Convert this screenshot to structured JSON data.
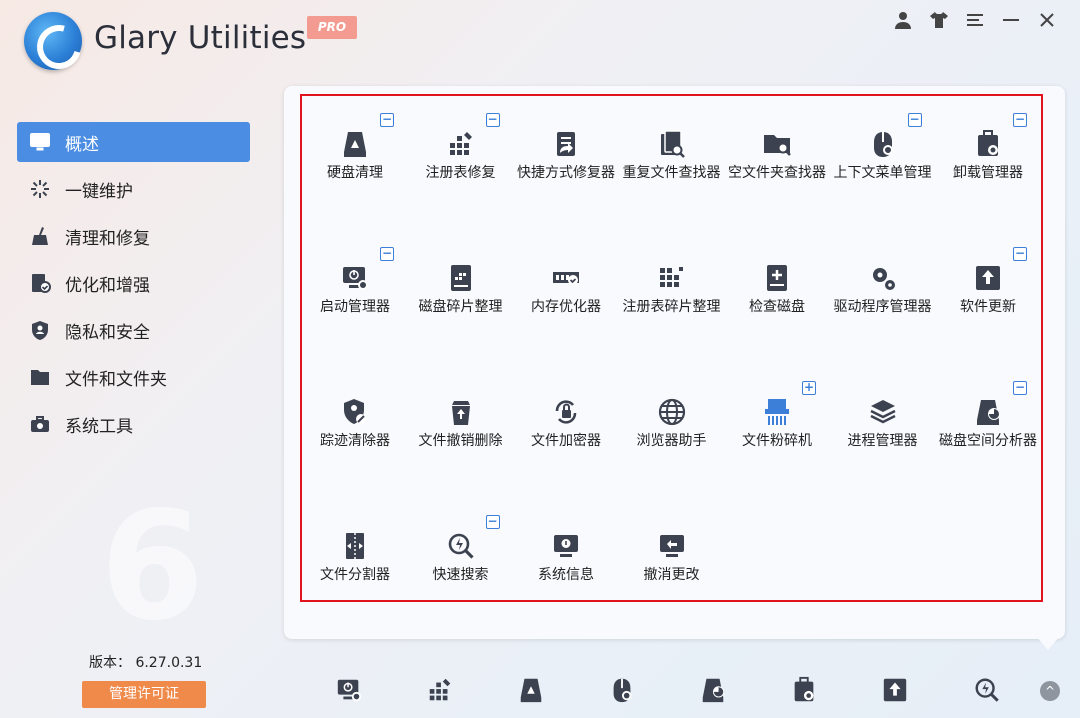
{
  "app": {
    "title": "Glary Utilities",
    "badge": "PRO",
    "brand_color": "#2b7fd6",
    "accent_color": "#4a8de3"
  },
  "window_controls": [
    {
      "name": "user-icon",
      "glyph": "👤"
    },
    {
      "name": "skin-icon",
      "glyph": "👕"
    },
    {
      "name": "menu-icon",
      "glyph": "☰"
    },
    {
      "name": "minimize-icon",
      "glyph": "—"
    },
    {
      "name": "close-icon",
      "glyph": "✕"
    }
  ],
  "sidebar": {
    "items": [
      {
        "label": "概述",
        "icon": "monitor-icon",
        "active": true
      },
      {
        "label": "一键维护",
        "icon": "sparkle-icon",
        "active": false
      },
      {
        "label": "清理和修复",
        "icon": "broom-icon",
        "active": false
      },
      {
        "label": "优化和增强",
        "icon": "optimize-icon",
        "active": false
      },
      {
        "label": "隐私和安全",
        "icon": "shield-icon",
        "active": false
      },
      {
        "label": "文件和文件夹",
        "icon": "folder-icon",
        "active": false
      },
      {
        "label": "系统工具",
        "icon": "toolbox-icon",
        "active": false
      }
    ],
    "watermark": "6",
    "version": "版本：  6.27.0.31",
    "license_button": "管理许可证"
  },
  "tools": [
    {
      "label": "硬盘清理",
      "icon": "disk-cleaner-icon",
      "badge": "minus"
    },
    {
      "label": "注册表修复",
      "icon": "registry-repair-icon",
      "badge": "minus"
    },
    {
      "label": "快捷方式修复器",
      "icon": "shortcut-fixer-icon",
      "badge": ""
    },
    {
      "label": "重复文件查找器",
      "icon": "duplicate-finder-icon",
      "badge": ""
    },
    {
      "label": "空文件夹查找器",
      "icon": "empty-folder-icon",
      "badge": ""
    },
    {
      "label": "上下文菜单管理",
      "icon": "context-menu-icon",
      "badge": "minus"
    },
    {
      "label": "卸载管理器",
      "icon": "uninstall-icon",
      "badge": "minus"
    },
    {
      "label": "启动管理器",
      "icon": "startup-manager-icon",
      "badge": "minus"
    },
    {
      "label": "磁盘碎片整理",
      "icon": "defrag-icon",
      "badge": ""
    },
    {
      "label": "内存优化器",
      "icon": "memory-icon",
      "badge": ""
    },
    {
      "label": "注册表碎片整理",
      "icon": "registry-defrag-icon",
      "badge": ""
    },
    {
      "label": "检查磁盘",
      "icon": "check-disk-icon",
      "badge": ""
    },
    {
      "label": "驱动程序管理器",
      "icon": "driver-manager-icon",
      "badge": ""
    },
    {
      "label": "软件更新",
      "icon": "software-update-icon",
      "badge": "minus"
    },
    {
      "label": "踪迹清除器",
      "icon": "tracks-eraser-icon",
      "badge": ""
    },
    {
      "label": "文件撤销删除",
      "icon": "undelete-icon",
      "badge": ""
    },
    {
      "label": "文件加密器",
      "icon": "encrypt-icon",
      "badge": ""
    },
    {
      "label": "浏览器助手",
      "icon": "browser-icon",
      "badge": ""
    },
    {
      "label": "文件粉碎机",
      "icon": "shredder-icon",
      "badge": "plus"
    },
    {
      "label": "进程管理器",
      "icon": "process-manager-icon",
      "badge": ""
    },
    {
      "label": "磁盘空间分析器",
      "icon": "disk-analysis-icon",
      "badge": "minus"
    },
    {
      "label": "文件分割器",
      "icon": "file-splitter-icon",
      "badge": ""
    },
    {
      "label": "快速搜索",
      "icon": "quick-search-icon",
      "badge": "minus"
    },
    {
      "label": "系统信息",
      "icon": "system-info-icon",
      "badge": ""
    },
    {
      "label": "撤消更改",
      "icon": "undo-changes-icon",
      "badge": ""
    }
  ],
  "bottom_bar": [
    "startup-manager-icon",
    "registry-repair-icon",
    "disk-cleaner-icon",
    "context-menu-icon",
    "disk-analysis-icon",
    "uninstall-icon",
    "software-update-icon",
    "quick-search-icon"
  ],
  "bottom_up_glyph": "^"
}
